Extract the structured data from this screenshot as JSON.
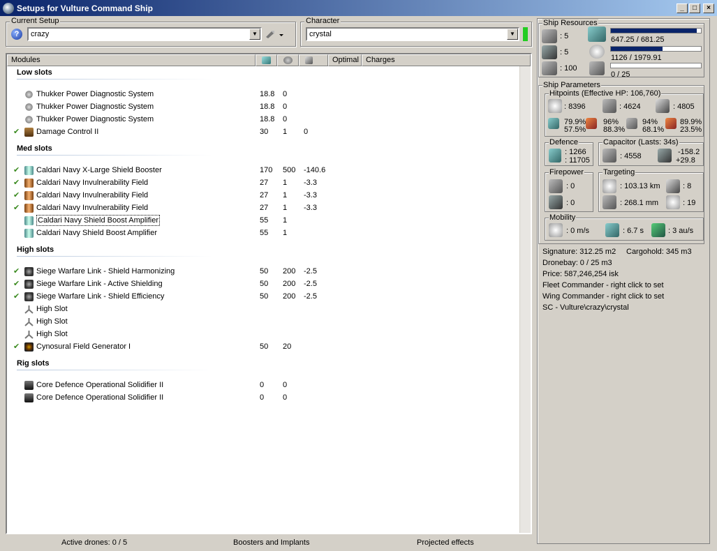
{
  "window": {
    "title": "Setups for Vulture Command Ship",
    "minimize_glyph": "_",
    "maximize_glyph": "□",
    "close_glyph": "×"
  },
  "setup": {
    "legend": "Current Setup",
    "value": "crazy",
    "help_glyph": "?",
    "dropdown_glyph": "▼"
  },
  "character": {
    "legend": "Character",
    "value": "crystal",
    "dropdown_glyph": "▼",
    "status_color": "#22cc22"
  },
  "modules": {
    "columns": [
      "Modules",
      "",
      "",
      "",
      "Optimal",
      "Charges"
    ],
    "sections": [
      {
        "title": "Low slots",
        "items": [
          {
            "checked": false,
            "icon": "power-diagnostic-icon",
            "name": "Thukker Power Diagnostic System",
            "v1": "18.8",
            "v2": "0",
            "v3": ""
          },
          {
            "checked": false,
            "icon": "power-diagnostic-icon",
            "name": "Thukker Power Diagnostic System",
            "v1": "18.8",
            "v2": "0",
            "v3": ""
          },
          {
            "checked": false,
            "icon": "power-diagnostic-icon",
            "name": "Thukker Power Diagnostic System",
            "v1": "18.8",
            "v2": "0",
            "v3": ""
          },
          {
            "checked": true,
            "icon": "damage-control-icon",
            "name": "Damage Control II",
            "v1": "30",
            "v2": "1",
            "v3": "0"
          }
        ]
      },
      {
        "title": "Med slots",
        "items": [
          {
            "checked": true,
            "icon": "shield-booster-icon",
            "name": "Caldari Navy X-Large Shield Booster",
            "v1": "170",
            "v2": "500",
            "v3": "-140.6"
          },
          {
            "checked": true,
            "icon": "invulnerability-field-icon",
            "name": "Caldari Navy Invulnerability Field",
            "v1": "27",
            "v2": "1",
            "v3": "-3.3"
          },
          {
            "checked": true,
            "icon": "invulnerability-field-icon",
            "name": "Caldari Navy Invulnerability Field",
            "v1": "27",
            "v2": "1",
            "v3": "-3.3"
          },
          {
            "checked": true,
            "icon": "invulnerability-field-icon",
            "name": "Caldari Navy Invulnerability Field",
            "v1": "27",
            "v2": "1",
            "v3": "-3.3"
          },
          {
            "checked": false,
            "icon": "shield-boost-amplifier-icon",
            "name": "Caldari Navy Shield Boost Amplifier",
            "v1": "55",
            "v2": "1",
            "v3": "",
            "selected": true
          },
          {
            "checked": false,
            "icon": "shield-boost-amplifier-icon",
            "name": "Caldari Navy Shield Boost Amplifier",
            "v1": "55",
            "v2": "1",
            "v3": ""
          }
        ]
      },
      {
        "title": "High slots",
        "items": [
          {
            "checked": true,
            "icon": "warfare-link-icon",
            "name": "Siege Warfare Link - Shield Harmonizing",
            "v1": "50",
            "v2": "200",
            "v3": "-2.5"
          },
          {
            "checked": true,
            "icon": "warfare-link-icon",
            "name": "Siege Warfare Link - Active Shielding",
            "v1": "50",
            "v2": "200",
            "v3": "-2.5"
          },
          {
            "checked": true,
            "icon": "warfare-link-icon",
            "name": "Siege Warfare Link - Shield Efficiency",
            "v1": "50",
            "v2": "200",
            "v3": "-2.5"
          },
          {
            "checked": false,
            "icon": "empty-high-slot-icon",
            "name": "High Slot",
            "v1": "",
            "v2": "",
            "v3": ""
          },
          {
            "checked": false,
            "icon": "empty-high-slot-icon",
            "name": "High Slot",
            "v1": "",
            "v2": "",
            "v3": ""
          },
          {
            "checked": false,
            "icon": "empty-high-slot-icon",
            "name": "High Slot",
            "v1": "",
            "v2": "",
            "v3": ""
          },
          {
            "checked": true,
            "icon": "cyno-field-icon",
            "name": "Cynosural Field Generator I",
            "v1": "50",
            "v2": "20",
            "v3": ""
          }
        ]
      },
      {
        "title": "Rig slots",
        "items": [
          {
            "checked": false,
            "icon": "rig-icon",
            "name": "Core Defence Operational Solidifier II",
            "v1": "0",
            "v2": "0",
            "v3": ""
          },
          {
            "checked": false,
            "icon": "rig-icon",
            "name": "Core Defence Operational Solidifier II",
            "v1": "0",
            "v2": "0",
            "v3": ""
          }
        ]
      }
    ]
  },
  "status": {
    "drones": "Active drones: 0 / 5",
    "boosters": "Boosters and Implants",
    "projected": "Projected effects"
  },
  "resources": {
    "legend": "Ship Resources",
    "turrets": ": 5",
    "launchers": ": 5",
    "calibration": ": 100",
    "cpu": "647.25 / 681.25",
    "cpu_fraction": 0.95,
    "powergrid": "1126 / 1979.91",
    "powergrid_fraction": 0.57,
    "drone_bandwidth": "0 / 25",
    "drone_bandwidth_fraction": 0
  },
  "params": {
    "legend": "Ship Parameters",
    "hitpoints": {
      "legend": "Hitpoints (Effective HP: 106,760)",
      "shield": ": 8396",
      "armor": ": 4624",
      "hull": ": 4805",
      "em_shield": "79.9%",
      "em_armor": "57.5%",
      "th_shield": "96%",
      "th_armor": "88.3%",
      "ki_shield": "94%",
      "ki_armor": "68.1%",
      "ex_shield": "89.9%",
      "ex_armor": "23.5%"
    },
    "defence": {
      "legend": "Defence",
      "a": ": 1266",
      "b": ": 11705"
    },
    "capacitor": {
      "legend": "Capacitor (Lasts: 34s)",
      "amount": ": 4558",
      "delta_neg": "-158.2",
      "delta_pos": "+29.8"
    },
    "firepower": {
      "legend": "Firepower",
      "a": ": 0",
      "b": ": 0"
    },
    "targeting": {
      "legend": "Targeting",
      "range": ": 103.13 km",
      "targets": ": 8",
      "scan": ": 268.1 mm",
      "sensor": ": 19"
    },
    "mobility": {
      "legend": "Mobility",
      "speed": ": 0 m/s",
      "align": ": 6.7 s",
      "warp": ": 3 au/s"
    }
  },
  "info": {
    "signature": "Signature: 312.25 m2",
    "cargohold": "Cargohold: 345 m3",
    "dronebay": "Dronebay: 0 / 25 m3",
    "price": "Price: 587,246,254 isk",
    "fleet": "Fleet Commander - right click to set",
    "wing": "Wing Commander - right click to set",
    "path": "SC - Vulture\\crazy\\crystal"
  }
}
